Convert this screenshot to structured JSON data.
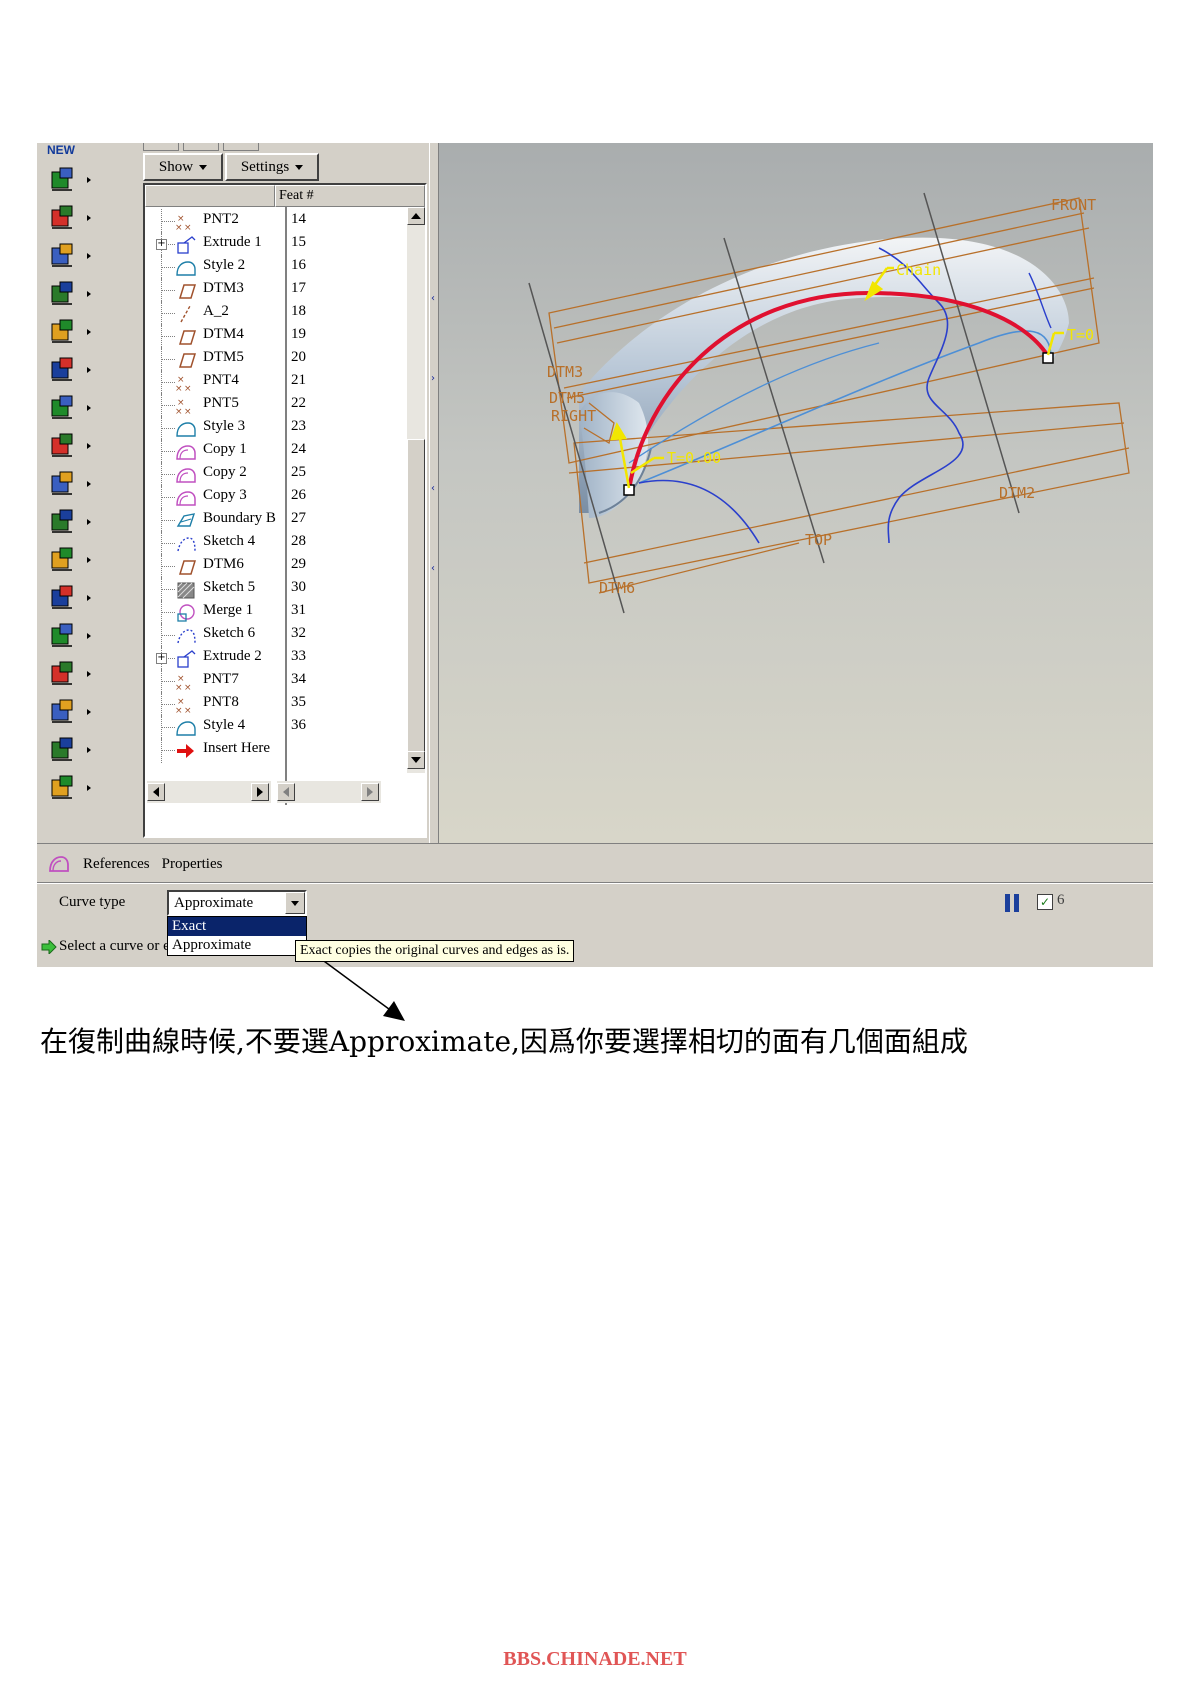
{
  "toolbar": {
    "new_label": "NEW",
    "tools": [
      {
        "icon": "coil-icon"
      },
      {
        "icon": "variable-section-sweep-icon"
      },
      {
        "icon": "helical-sweep-icon"
      },
      {
        "icon": "swept-blend-icon"
      },
      {
        "icon": "boundary-blend-icon"
      },
      {
        "icon": "style-icon"
      },
      {
        "icon": "merge-icon"
      },
      {
        "icon": "trim-icon"
      },
      {
        "icon": "pattern-icon"
      },
      {
        "icon": "database-icon"
      },
      {
        "icon": "offset-icon"
      },
      {
        "icon": "thicken-icon"
      },
      {
        "icon": "solidify-icon"
      },
      {
        "icon": "wall-icon"
      },
      {
        "icon": "point-grid-icon"
      },
      {
        "icon": "mirror-icon"
      },
      {
        "icon": "move-icon"
      }
    ]
  },
  "model_tree": {
    "show_label": "Show",
    "settings_label": "Settings",
    "column_header": "Feat #",
    "rows": [
      {
        "name": "PNT2",
        "num": "14",
        "icon": "datum-point-icon",
        "expandable": false
      },
      {
        "name": "Extrude 1",
        "num": "15",
        "icon": "extrude-icon",
        "expandable": true
      },
      {
        "name": "Style 2",
        "num": "16",
        "icon": "style-feature-icon",
        "expandable": false
      },
      {
        "name": "DTM3",
        "num": "17",
        "icon": "datum-plane-icon",
        "expandable": false
      },
      {
        "name": "A_2",
        "num": "18",
        "icon": "datum-axis-icon",
        "expandable": false
      },
      {
        "name": "DTM4",
        "num": "19",
        "icon": "datum-plane-icon",
        "expandable": false
      },
      {
        "name": "DTM5",
        "num": "20",
        "icon": "datum-plane-icon",
        "expandable": false
      },
      {
        "name": "PNT4",
        "num": "21",
        "icon": "datum-point-icon",
        "expandable": false
      },
      {
        "name": "PNT5",
        "num": "22",
        "icon": "datum-point-icon",
        "expandable": false
      },
      {
        "name": "Style 3",
        "num": "23",
        "icon": "style-feature-icon",
        "expandable": false
      },
      {
        "name": "Copy 1",
        "num": "24",
        "icon": "copy-surface-icon",
        "expandable": false
      },
      {
        "name": "Copy 2",
        "num": "25",
        "icon": "copy-surface-icon",
        "expandable": false
      },
      {
        "name": "Copy 3",
        "num": "26",
        "icon": "copy-surface-icon",
        "expandable": false
      },
      {
        "name": "Boundary B",
        "num": "27",
        "icon": "boundary-blend-feature-icon",
        "expandable": false
      },
      {
        "name": "Sketch 4",
        "num": "28",
        "icon": "sketch-icon",
        "expandable": false
      },
      {
        "name": "DTM6",
        "num": "29",
        "icon": "datum-plane-icon",
        "expandable": false
      },
      {
        "name": "Sketch 5",
        "num": "30",
        "icon": "sketch-hatched-icon",
        "expandable": false
      },
      {
        "name": "Merge 1",
        "num": "31",
        "icon": "merge-feature-icon",
        "expandable": false
      },
      {
        "name": "Sketch 6",
        "num": "32",
        "icon": "sketch-icon",
        "expandable": false
      },
      {
        "name": "Extrude 2",
        "num": "33",
        "icon": "extrude-icon",
        "expandable": true
      },
      {
        "name": "PNT7",
        "num": "34",
        "icon": "datum-point-icon",
        "expandable": false
      },
      {
        "name": "PNT8",
        "num": "35",
        "icon": "datum-point-icon",
        "expandable": false
      },
      {
        "name": "Style 4",
        "num": "36",
        "icon": "style-feature-icon",
        "expandable": false
      },
      {
        "name": "Insert Here",
        "num": "",
        "icon": "insert-here-arrow-icon",
        "expandable": false
      }
    ]
  },
  "viewport": {
    "labels": {
      "front": "FRONT",
      "chain": "Chain",
      "t_end": "T=0",
      "t_start": "T=0.00",
      "dtm3": "DTM3",
      "dtm5": "DTM5",
      "right": "RIGHT",
      "dtm2": "DTM2",
      "top": "TOP",
      "dtm6": "DTM6"
    },
    "colors": {
      "datum": "#b8702a",
      "selected_curve": "#e01030",
      "blue_curve": "#2a3fcc",
      "light_curve": "#4d8fd6",
      "annotation": "#f2e600"
    }
  },
  "dashboard": {
    "tab_references": "References",
    "tab_properties": "Properties",
    "curve_type_label": "Curve type",
    "curve_type_value": "Approximate",
    "options": [
      "Exact",
      "Approximate"
    ],
    "selected_option_index": 0,
    "status_text": "Select a curve or edge",
    "tooltip": "Exact copies the original curves and edges as is."
  },
  "caption": "在復制曲線時候,不要選Approximate,因爲你要選擇相切的面有几個面組成",
  "watermark": "BBS.CHINADE.NET"
}
